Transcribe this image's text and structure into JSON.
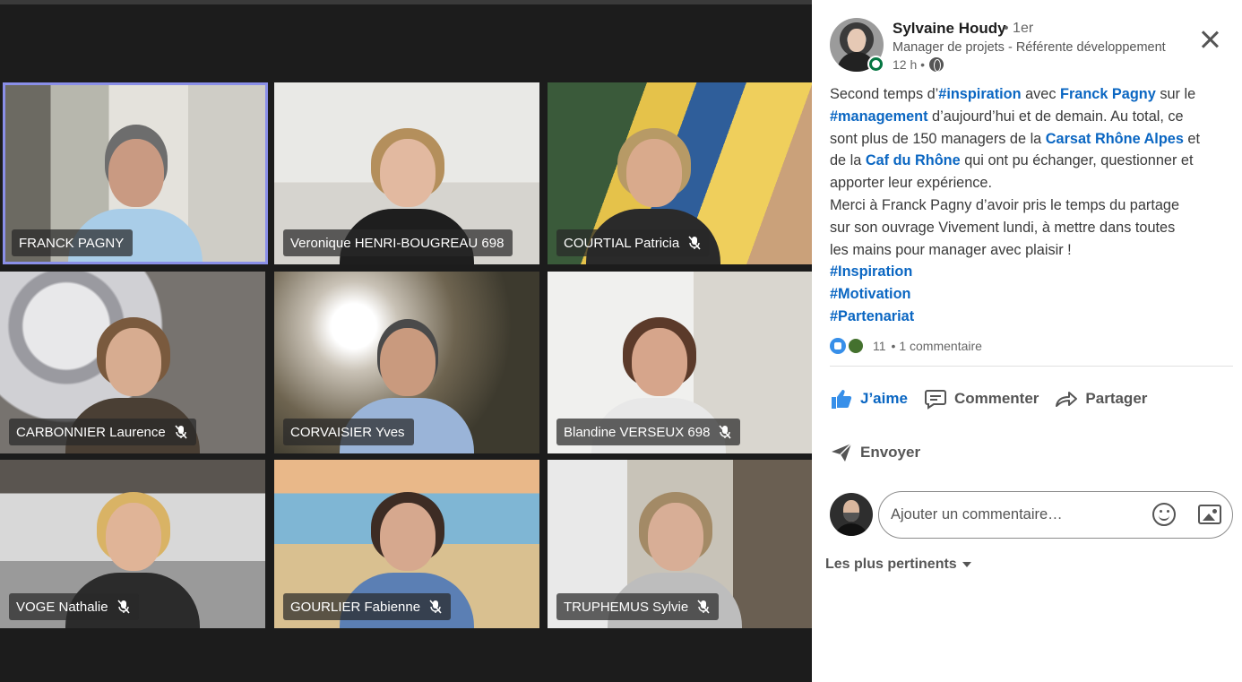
{
  "video_call": {
    "participants": [
      {
        "name": "FRANCK PAGNY",
        "muted": false,
        "active": true
      },
      {
        "name": "Veronique HENRI-BOUGREAU 698",
        "muted": false,
        "active": false
      },
      {
        "name": "COURTIAL Patricia",
        "muted": true,
        "active": false
      },
      {
        "name": "CARBONNIER Laurence",
        "muted": true,
        "active": false
      },
      {
        "name": "CORVAISIER Yves",
        "muted": false,
        "active": false
      },
      {
        "name": "Blandine VERSEUX 698",
        "muted": true,
        "active": false
      },
      {
        "name": "VOGE Nathalie",
        "muted": true,
        "active": false
      },
      {
        "name": "GOURLIER Fabienne",
        "muted": true,
        "active": false
      },
      {
        "name": "TRUPHEMUS Sylvie",
        "muted": true,
        "active": false
      }
    ]
  },
  "post": {
    "author": "Sylvaine Houdy",
    "degree": "• 1er",
    "headline": "Manager de projets - Référente développement",
    "time": "12 h •",
    "text_lines": [
      [
        {
          "t": "Second temps d’"
        },
        {
          "t": "#inspiration",
          "hl": true
        },
        {
          "t": " avec "
        },
        {
          "t": "Franck Pagny",
          "hl": true
        },
        {
          "t": " sur le"
        }
      ],
      [
        {
          "t": "#management",
          "hl": true
        },
        {
          "t": " d’aujourd’hui et de demain. Au total, ce"
        }
      ],
      [
        {
          "t": "sont plus de 150 managers de la "
        },
        {
          "t": "Carsat Rhône Alpes",
          "hl": true
        },
        {
          "t": " et"
        }
      ],
      [
        {
          "t": "de la "
        },
        {
          "t": "Caf du Rhône",
          "hl": true
        },
        {
          "t": " qui ont pu échanger, questionner et"
        }
      ],
      [
        {
          "t": "apporter leur expérience."
        }
      ],
      [
        {
          "t": "Merci à Franck Pagny d’avoir pris le temps du partage"
        }
      ],
      [
        {
          "t": "sur son ouvrage Vivement lundi, à mettre dans toutes"
        }
      ],
      [
        {
          "t": "les mains pour manager avec plaisir !"
        }
      ],
      [
        {
          "t": "#Inspiration",
          "hl": true
        }
      ],
      [
        {
          "t": "#Motivation",
          "hl": true
        }
      ],
      [
        {
          "t": "#Partenariat",
          "hl": true
        }
      ]
    ],
    "reactions_count": "11",
    "comments_count": "• 1 commentaire",
    "actions": {
      "like": "J’aime",
      "comment": "Commenter",
      "share": "Partager",
      "send": "Envoyer"
    },
    "comment_placeholder": "Ajouter un commentaire…",
    "sort_label": "Les plus pertinents",
    "colors": {
      "link": "#0a66c2",
      "online": "#057642"
    }
  }
}
